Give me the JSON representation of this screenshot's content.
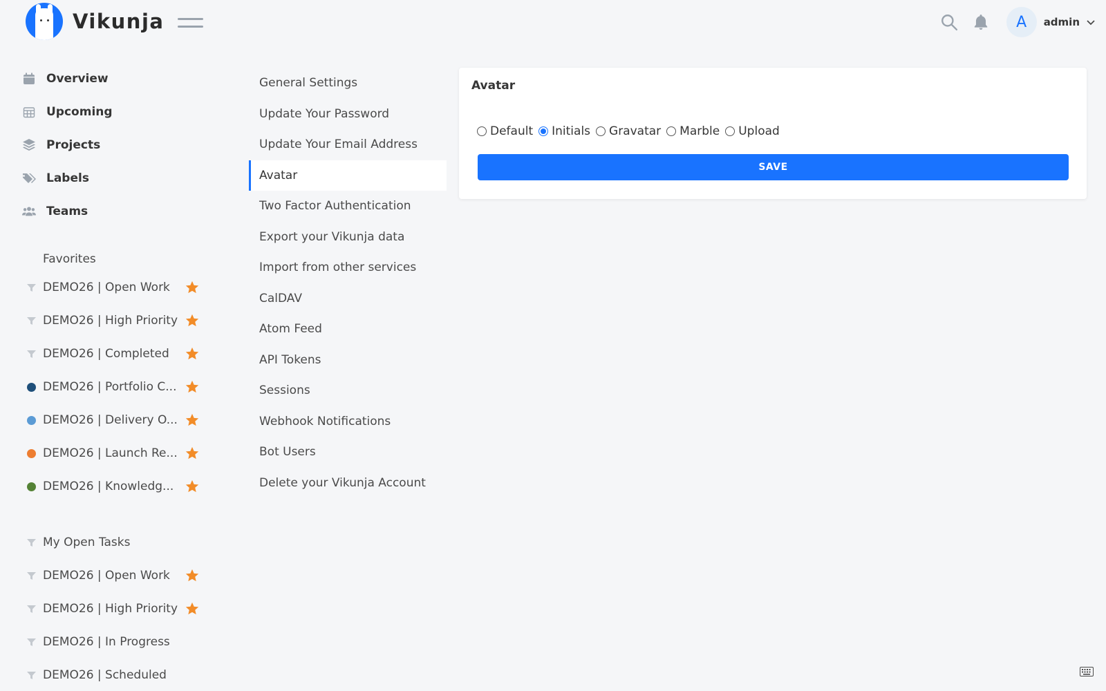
{
  "app": {
    "name": "Vikunja"
  },
  "header": {
    "avatar_letter": "A",
    "username": "admin"
  },
  "nav": [
    {
      "label": "Overview",
      "icon": "calendar-icon"
    },
    {
      "label": "Upcoming",
      "icon": "calendar-grid-icon"
    },
    {
      "label": "Projects",
      "icon": "layers-icon"
    },
    {
      "label": "Labels",
      "icon": "tags-icon"
    },
    {
      "label": "Teams",
      "icon": "users-icon"
    }
  ],
  "favorites": {
    "title": "Favorites",
    "items": [
      {
        "label": "DEMO26 | Open Work",
        "kind": "filter",
        "starred": true
      },
      {
        "label": "DEMO26 | High Priority",
        "kind": "filter",
        "starred": true
      },
      {
        "label": "DEMO26 | Completed",
        "kind": "filter",
        "starred": true
      },
      {
        "label": "DEMO26 | Portfolio C...",
        "kind": "dot",
        "color": "#1e4f7a",
        "starred": true
      },
      {
        "label": "DEMO26 | Delivery O...",
        "kind": "dot",
        "color": "#5b9bd5",
        "starred": true
      },
      {
        "label": "DEMO26 | Launch Re...",
        "kind": "dot",
        "color": "#ed7d31",
        "starred": true
      },
      {
        "label": "DEMO26 | Knowledg...",
        "kind": "dot",
        "color": "#548235",
        "starred": true
      }
    ]
  },
  "projects": [
    {
      "label": "My Open Tasks",
      "kind": "filter",
      "starred": false
    },
    {
      "label": "DEMO26 | Open Work",
      "kind": "filter",
      "starred": true
    },
    {
      "label": "DEMO26 | High Priority",
      "kind": "filter",
      "starred": true
    },
    {
      "label": "DEMO26 | In Progress",
      "kind": "filter",
      "starred": false
    },
    {
      "label": "DEMO26 | Scheduled",
      "kind": "filter",
      "starred": false
    }
  ],
  "settings_menu": [
    "General Settings",
    "Update Your Password",
    "Update Your Email Address",
    "Avatar",
    "Two Factor Authentication",
    "Export your Vikunja data",
    "Import from other services",
    "CalDAV",
    "Atom Feed",
    "API Tokens",
    "Sessions",
    "Webhook Notifications",
    "Bot Users",
    "Delete your Vikunja Account"
  ],
  "settings_active_index": 3,
  "avatar_card": {
    "title": "Avatar",
    "options": [
      "Default",
      "Initials",
      "Gravatar",
      "Marble",
      "Upload"
    ],
    "selected": "Initials",
    "save_label": "SAVE"
  },
  "colors": {
    "accent": "#1973ff",
    "star": "#f28c28",
    "background": "#f5f6f8"
  }
}
